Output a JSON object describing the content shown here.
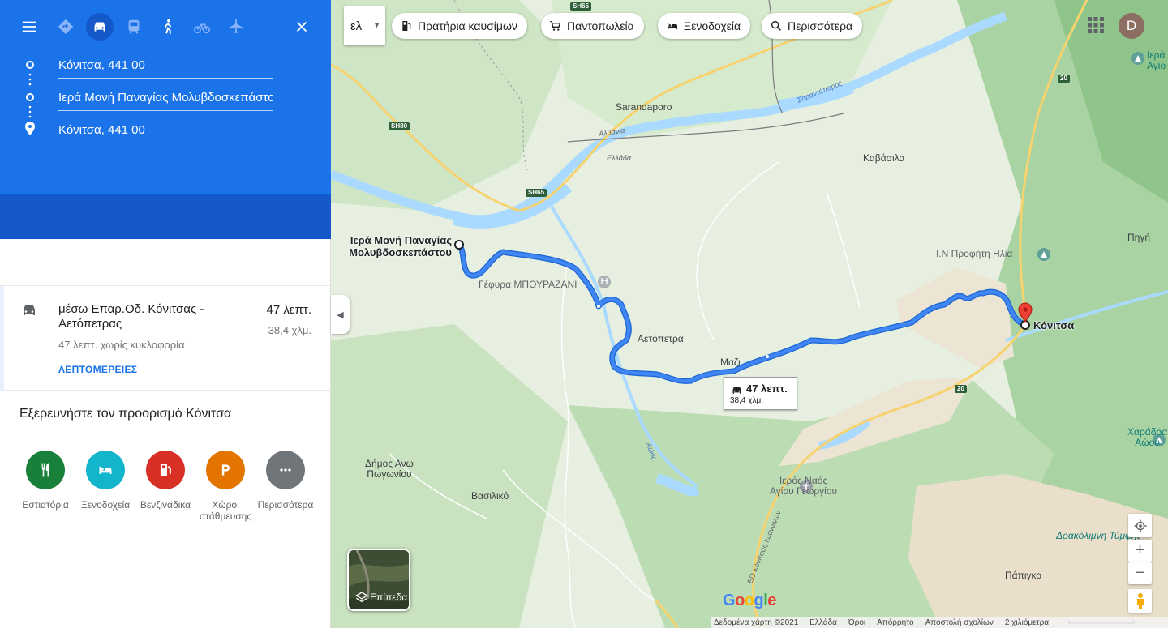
{
  "panel": {
    "modes": [
      {
        "name": "menu-icon"
      },
      {
        "name": "best-route-icon"
      },
      {
        "name": "car-icon"
      },
      {
        "name": "transit-icon"
      },
      {
        "name": "walk-icon"
      },
      {
        "name": "bike-icon"
      },
      {
        "name": "flight-icon"
      },
      {
        "name": "close-icon"
      }
    ],
    "waypoints": [
      "Κόνιτσα, 441 00",
      "Ιερά Μονή Παναγίας Μολυβδοσκεπάστου",
      "Κόνιτσα, 441 00"
    ],
    "route": {
      "title": "μέσω Επαρ.Οδ. Κόνιτσας - Αετόπετρας",
      "time": "47 λεπτ.",
      "distance": "38,4 χλμ.",
      "traffic": "47 λεπτ. χωρίς κυκλοφορία",
      "details": "ΛΕΠΤΟΜΕΡΕΙΕΣ"
    },
    "explore": {
      "title": "Εξερευνήστε τον προορισμό Κόνιτσα",
      "categories": [
        {
          "label": "Εστιατόρια",
          "color": "#188038",
          "icon": "restaurant-icon"
        },
        {
          "label": "Ξενοδοχεία",
          "color": "#12b5cb",
          "icon": "hotel-icon"
        },
        {
          "label": "Βενζινάδικα",
          "color": "#d93025",
          "icon": "gas-icon"
        },
        {
          "label": "Χώροι στάθμευσης",
          "color": "#e37400",
          "icon": "parking-icon"
        },
        {
          "label": "Περισσότερα",
          "color": "#70757a",
          "icon": "more-icon"
        }
      ]
    }
  },
  "map": {
    "lang": "ελ",
    "chips": [
      "Πρατήρια καυσίμων",
      "Παντοπωλεία",
      "Ξενοδοχεία",
      "Περισσότερα"
    ],
    "avatar": "D",
    "route_box": {
      "time": "47 λεπτ.",
      "distance": "38,4 χλμ."
    },
    "labels": {
      "monastery_line1": "Ιερά Μονή Παναγίας",
      "monastery_line2": "Μολυβδοσκεπάστου",
      "konitsa": "Κόνιτσα",
      "sarandaporo": "Sarandaporo",
      "kavasila": "Καβάσιλα",
      "gefyra": "Γέφυρα ΜΠΟΥΡΑΖΑΝΙ",
      "aetopetra": "Αετόπετρα",
      "mazi": "Μαζι",
      "dimos_line1": "Δήμος Ανω",
      "dimos_line2": "Πωγωνίου",
      "vasiliko": "Βασιλικό",
      "ieros_line1": "Ιερός Ναός",
      "ieros_line2": "Αγίου Γεωργίου",
      "profiti": "Ι.Ν Προφήτη Ηλία",
      "pigi": "Πηγή",
      "charadra_line1": "Χαράδρα",
      "charadra_line2": "Αώου",
      "drakolimni": "Δρακόλιμνη Τύμφης",
      "papigko": "Πάπιγκο",
      "ieras_agiou_line1": "Ιερά",
      "ieras_agiou_line2": "Αγίο",
      "albania": "Αλβανία",
      "ellada": "Ελλάδα",
      "sarantaporos": "Σαραντάπορος",
      "aoos": "Αώος",
      "eo_road": "ΕΟ Κόνιτσας-Ιωαννίνων",
      "sh80": "SH80",
      "sh65a": "SH65",
      "sh65b": "SH65",
      "r20a": "20",
      "r20b": "20",
      "google": "Google"
    },
    "layers_label": "Επίπεδα",
    "footer": {
      "data": "Δεδομένα χάρτη ©2021",
      "country": "Ελλάδα",
      "terms": "Όροι",
      "privacy": "Απόρρητο",
      "feedback": "Αποστολή σχολίων",
      "scale": "2 χιλιόμετρα"
    },
    "colors": {
      "route": "#4285f4",
      "route_dark": "#1967d2",
      "pin": "#ea4335",
      "water": "#aadaff",
      "panel_blue": "#1a73e8"
    }
  }
}
